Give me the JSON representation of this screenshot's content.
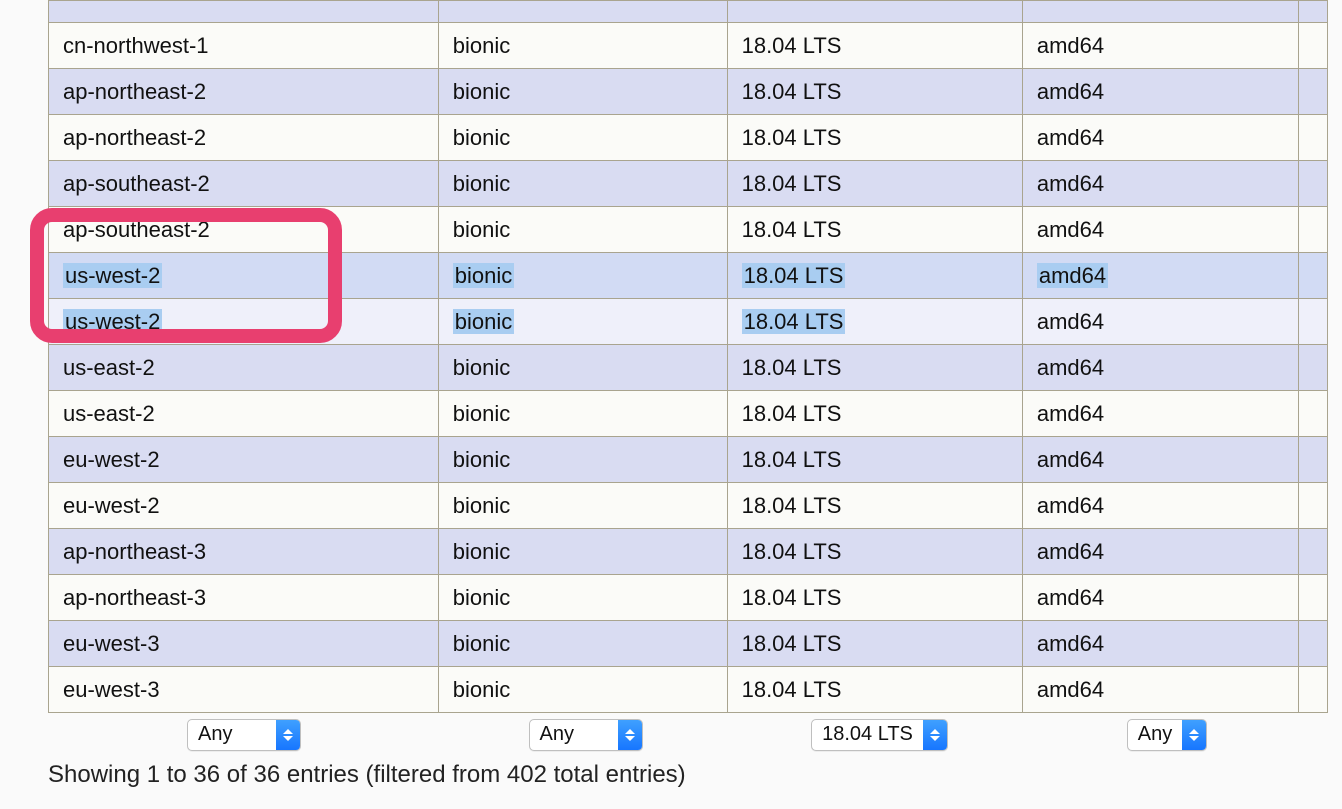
{
  "rows": [
    {
      "region": "",
      "name": "",
      "version": "",
      "arch": "",
      "cls": "top odd"
    },
    {
      "region": "cn-northwest-1",
      "name": "bionic",
      "version": "18.04 LTS",
      "arch": "amd64",
      "cls": "even"
    },
    {
      "region": "ap-northeast-2",
      "name": "bionic",
      "version": "18.04 LTS",
      "arch": "amd64",
      "cls": "odd"
    },
    {
      "region": "ap-northeast-2",
      "name": "bionic",
      "version": "18.04 LTS",
      "arch": "amd64",
      "cls": "even"
    },
    {
      "region": "ap-southeast-2",
      "name": "bionic",
      "version": "18.04 LTS",
      "arch": "amd64",
      "cls": "odd"
    },
    {
      "region": "ap-southeast-2",
      "name": "bionic",
      "version": "18.04 LTS",
      "arch": "amd64",
      "cls": "even"
    },
    {
      "region": "us-west-2",
      "name": "bionic",
      "version": "18.04 LTS",
      "arch": "amd64",
      "cls": "sel",
      "hl": [
        "region",
        "name",
        "version",
        "arch"
      ]
    },
    {
      "region": "us-west-2",
      "name": "bionic",
      "version": "18.04 LTS",
      "arch": "amd64",
      "cls": "sel-even",
      "hl": [
        "region",
        "name",
        "version"
      ]
    },
    {
      "region": "us-east-2",
      "name": "bionic",
      "version": "18.04 LTS",
      "arch": "amd64",
      "cls": "odd"
    },
    {
      "region": "us-east-2",
      "name": "bionic",
      "version": "18.04 LTS",
      "arch": "amd64",
      "cls": "even"
    },
    {
      "region": "eu-west-2",
      "name": "bionic",
      "version": "18.04 LTS",
      "arch": "amd64",
      "cls": "odd"
    },
    {
      "region": "eu-west-2",
      "name": "bionic",
      "version": "18.04 LTS",
      "arch": "amd64",
      "cls": "even"
    },
    {
      "region": "ap-northeast-3",
      "name": "bionic",
      "version": "18.04 LTS",
      "arch": "amd64",
      "cls": "odd"
    },
    {
      "region": "ap-northeast-3",
      "name": "bionic",
      "version": "18.04 LTS",
      "arch": "amd64",
      "cls": "even"
    },
    {
      "region": "eu-west-3",
      "name": "bionic",
      "version": "18.04 LTS",
      "arch": "amd64",
      "cls": "odd"
    },
    {
      "region": "eu-west-3",
      "name": "bionic",
      "version": "18.04 LTS",
      "arch": "amd64",
      "cls": "even"
    }
  ],
  "filters": {
    "region": "Any",
    "name": "Any",
    "version": "18.04 LTS",
    "arch": "Any"
  },
  "status": "Showing 1 to 36 of 36 entries (filtered from 402 total entries)",
  "colors": {
    "accent": "#e83f6f",
    "select_blue": "#1776ff"
  }
}
